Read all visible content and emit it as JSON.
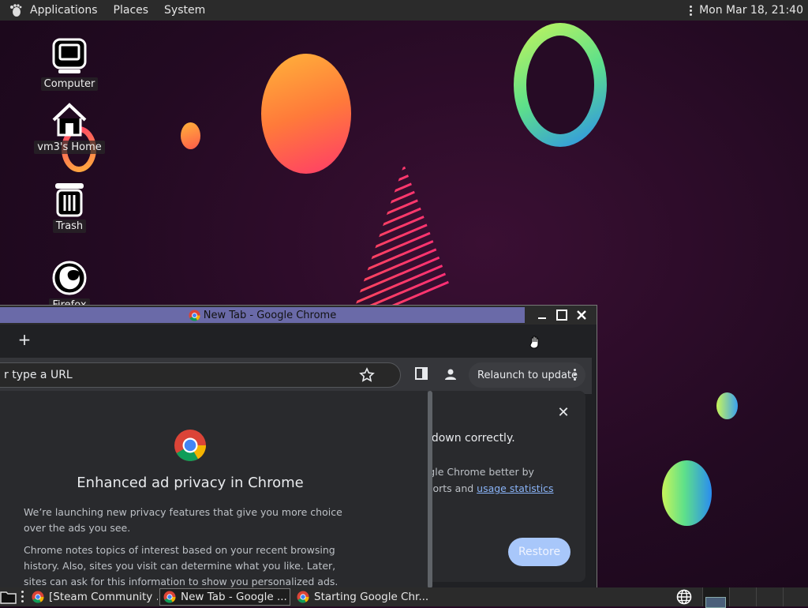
{
  "top_panel": {
    "menus": [
      "Applications",
      "Places",
      "System"
    ],
    "clock": "Mon Mar 18, 21:40"
  },
  "desktop": {
    "icons": [
      {
        "label": "Computer",
        "icon": "computer-icon"
      },
      {
        "label": "vm3's Home",
        "icon": "home-icon"
      },
      {
        "label": "Trash",
        "icon": "trash-icon"
      },
      {
        "label": "Firefox",
        "icon": "firefox-icon"
      }
    ]
  },
  "chrome": {
    "window_title": "New Tab - Google Chrome",
    "omnibox_placeholder": "r type a URL",
    "relaunch_label": "Relaunch to update",
    "restore_bubble": {
      "message": "ut down correctly.",
      "help_line1": "oogle Chrome better by",
      "help_line2_prefix": "reports and ",
      "help_link": "usage statistics",
      "restore_button": "Restore"
    },
    "privacy_dialog": {
      "title": "Enhanced ad privacy in Chrome",
      "p1": "We’re launching new privacy features that give you more choice over the ads you see.",
      "p2": "Chrome notes topics of interest based on your recent browsing history. Also, sites you visit can determine what you like. Later, sites can ask for this information to show you personalized ads. You can choose which"
    }
  },
  "taskbar": {
    "tasks": [
      {
        "label": "[Steam Community ..."
      },
      {
        "label": "New Tab - Google ..."
      },
      {
        "label": "Starting Google Chr..."
      }
    ]
  },
  "colors": {
    "panel_bg": "#2b2b2b",
    "title_active": "#6a6aa8",
    "restore_button": "#a8c7fa",
    "link": "#8ab4f8"
  }
}
